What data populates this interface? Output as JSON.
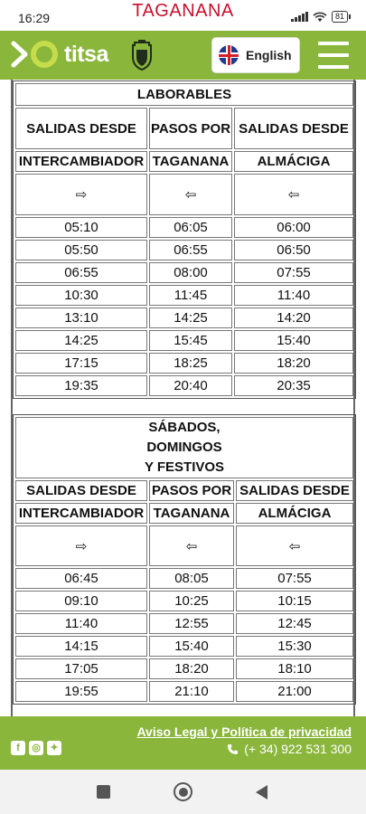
{
  "status": {
    "time": "16:29",
    "title": "TAGANANA",
    "battery": "81"
  },
  "header": {
    "logo_text": "titsa",
    "language_label": "English",
    "icons": [
      "titsa-logo-icon",
      "cabildo-crest-icon",
      "uk-flag-icon",
      "hamburger-menu-icon"
    ]
  },
  "weekday": {
    "title": "LABORABLES",
    "col_headers": [
      "SALIDAS DESDE",
      "PASOS POR",
      "SALIDAS DESDE"
    ],
    "places": [
      "INTERCAMBIADOR",
      "TAGANANA",
      "ALMÁCIGA"
    ],
    "arrows": [
      "⇨",
      "⇦",
      "⇦"
    ],
    "rows": [
      [
        "05:10",
        "06:05",
        "06:00"
      ],
      [
        "05:50",
        "06:55",
        "06:50"
      ],
      [
        "06:55",
        "08:00",
        "07:55"
      ],
      [
        "10:30",
        "11:45",
        "11:40"
      ],
      [
        "13:10",
        "14:25",
        "14:20"
      ],
      [
        "14:25",
        "15:45",
        "15:40"
      ],
      [
        "17:15",
        "18:25",
        "18:20"
      ],
      [
        "19:35",
        "20:40",
        "20:35"
      ]
    ]
  },
  "weekend": {
    "title": "SÁBADOS, DOMINGOS Y FESTIVOS",
    "col_headers": [
      "SALIDAS DESDE",
      "PASOS POR",
      "SALIDAS DESDE"
    ],
    "places": [
      "INTERCAMBIADOR",
      "TAGANANA",
      "ALMÁCIGA"
    ],
    "arrows": [
      "⇨",
      "⇦",
      "⇦"
    ],
    "rows": [
      [
        "06:45",
        "08:05",
        "07:55"
      ],
      [
        "09:10",
        "10:25",
        "10:15"
      ],
      [
        "11:40",
        "12:55",
        "12:45"
      ],
      [
        "14:15",
        "15:40",
        "15:30"
      ],
      [
        "17:05",
        "18:20",
        "18:10"
      ],
      [
        "19:55",
        "21:10",
        "21:00"
      ]
    ]
  },
  "footer": {
    "legal_link": "Aviso Legal y Política de privacidad",
    "phone": "(+ 34) 922 531 300",
    "socials": [
      "facebook-icon",
      "instagram-icon",
      "twitter-icon"
    ]
  },
  "colors": {
    "brand_green": "#8ab63c",
    "title_red": "#c8102e"
  }
}
